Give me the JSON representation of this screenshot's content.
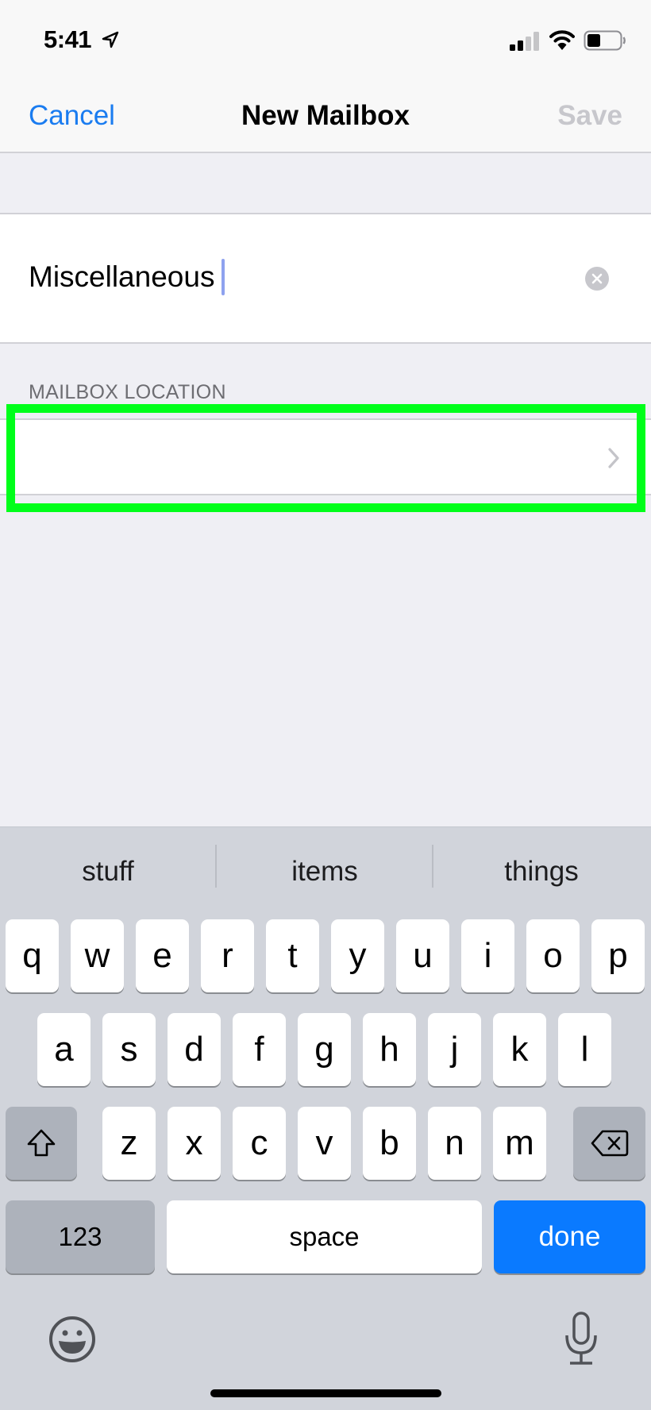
{
  "status_bar": {
    "time": "5:41",
    "location_icon": "location-arrow-icon",
    "signal_icon": "cellular-signal-icon",
    "signal_bars_filled": 2,
    "signal_bars_total": 4,
    "wifi_icon": "wifi-icon",
    "battery_icon": "battery-icon",
    "battery_level": 0.4
  },
  "nav": {
    "cancel_label": "Cancel",
    "title": "New Mailbox",
    "save_label": "Save",
    "accent_color": "#1a7cf0",
    "disabled_color": "#c7c7cc"
  },
  "name_field": {
    "value": "Miscellaneous",
    "clear_icon": "clear-circle-icon"
  },
  "location_section": {
    "header": "MAILBOX LOCATION",
    "row_value": "",
    "chevron_icon": "chevron-right-icon",
    "highlight_color": "#00ff1a"
  },
  "keyboard": {
    "suggestions": [
      "stuff",
      "items",
      "things"
    ],
    "row1": [
      "q",
      "w",
      "e",
      "r",
      "t",
      "y",
      "u",
      "i",
      "o",
      "p"
    ],
    "row2": [
      "a",
      "s",
      "d",
      "f",
      "g",
      "h",
      "j",
      "k",
      "l"
    ],
    "row3": [
      "z",
      "x",
      "c",
      "v",
      "b",
      "n",
      "m"
    ],
    "shift_icon": "shift-icon",
    "delete_icon": "delete-backspace-icon",
    "numbers_label": "123",
    "space_label": "space",
    "done_label": "done",
    "done_color": "#0a7aff",
    "emoji_icon": "emoji-icon",
    "mic_icon": "microphone-icon"
  }
}
